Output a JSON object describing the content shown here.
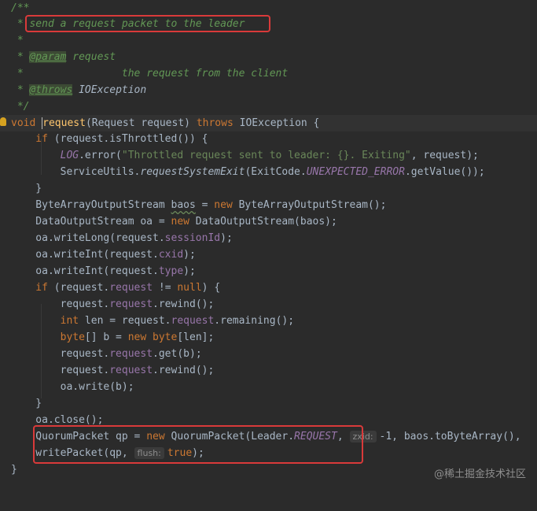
{
  "code": {
    "l1": "/**",
    "l2_star": " * ",
    "l2_text": "send a request packet to the leader",
    "l3": " *",
    "l4_star": " * ",
    "l4_tag": "@param",
    "l4_name": " request",
    "l5_star": " *",
    "l5_text": "                the request from the client",
    "l6_star": " * ",
    "l6_tag": "@throws",
    "l6_type": " IOException",
    "l7": " */",
    "l8_void": "void ",
    "l8_name": "request",
    "l8_rest": "(Request request) ",
    "l8_throws": "throws",
    "l8_tail": " IOException {",
    "l9_if": "    if",
    "l9_rest": " (request.isThrottled()) {",
    "l10_log": "        LOG",
    "l10_mid": ".error(",
    "l10_str": "\"Throttled request sent to leader: {}. Exiting\"",
    "l10_tail": ", request);",
    "l11_a": "        ServiceUtils.",
    "l11_method": "requestSystemExit",
    "l11_b": "(ExitCode.",
    "l11_const": "UNEXPECTED_ERROR",
    "l11_c": ".getValue());",
    "l12": "    }",
    "l13_a": "    ByteArrayOutputStream ",
    "l13_var": "baos",
    "l13_b": " = ",
    "l13_new": "new",
    "l13_c": " ByteArrayOutputStream();",
    "l14_a": "    DataOutputStream oa = ",
    "l14_new": "new",
    "l14_c": " DataOutputStream(baos);",
    "l15_a": "    oa.writeLong(request.",
    "l15_f": "sessionId",
    "l15_b": ");",
    "l16_a": "    oa.writeInt(request.",
    "l16_f": "cxid",
    "l16_b": ");",
    "l17_a": "    oa.writeInt(request.",
    "l17_f": "type",
    "l17_b": ");",
    "l18_if": "    if",
    "l18_a": " (request.",
    "l18_f": "request",
    "l18_b": " != ",
    "l18_null": "null",
    "l18_c": ") {",
    "l19_a": "        request.",
    "l19_f": "request",
    "l19_b": ".rewind();",
    "l20_int": "        int",
    "l20_a": " len = request.",
    "l20_f": "request",
    "l20_b": ".remaining();",
    "l21_byte": "        byte",
    "l21_a": "[] b = ",
    "l21_new": "new",
    "l21_byte2": " byte",
    "l21_b": "[len];",
    "l22_a": "        request.",
    "l22_f": "request",
    "l22_b": ".get(b);",
    "l23_a": "        request.",
    "l23_f": "request",
    "l23_b": ".rewind();",
    "l24": "        oa.write(b);",
    "l25": "    }",
    "l26": "    oa.close();",
    "l27_a": "    QuorumPacket qp = ",
    "l27_new": "new",
    "l27_b": " QuorumPacket(Leader.",
    "l27_const": "REQUEST",
    "l27_c": ", ",
    "l27_hint": "zxid:",
    "l27_d": "-1, baos.toByteArray(),",
    "l28_a": "    writePacket(qp, ",
    "l28_hint": "flush:",
    "l28_true": "true",
    "l28_b": ");",
    "l29": "}"
  },
  "watermark": "@稀土掘金技术社区",
  "colors": {
    "background": "#2b2b2b",
    "keyword": "#cc7832",
    "string": "#6a8759",
    "field": "#9876aa",
    "doc_comment": "#629755",
    "highlight_box": "#d93a3a"
  }
}
